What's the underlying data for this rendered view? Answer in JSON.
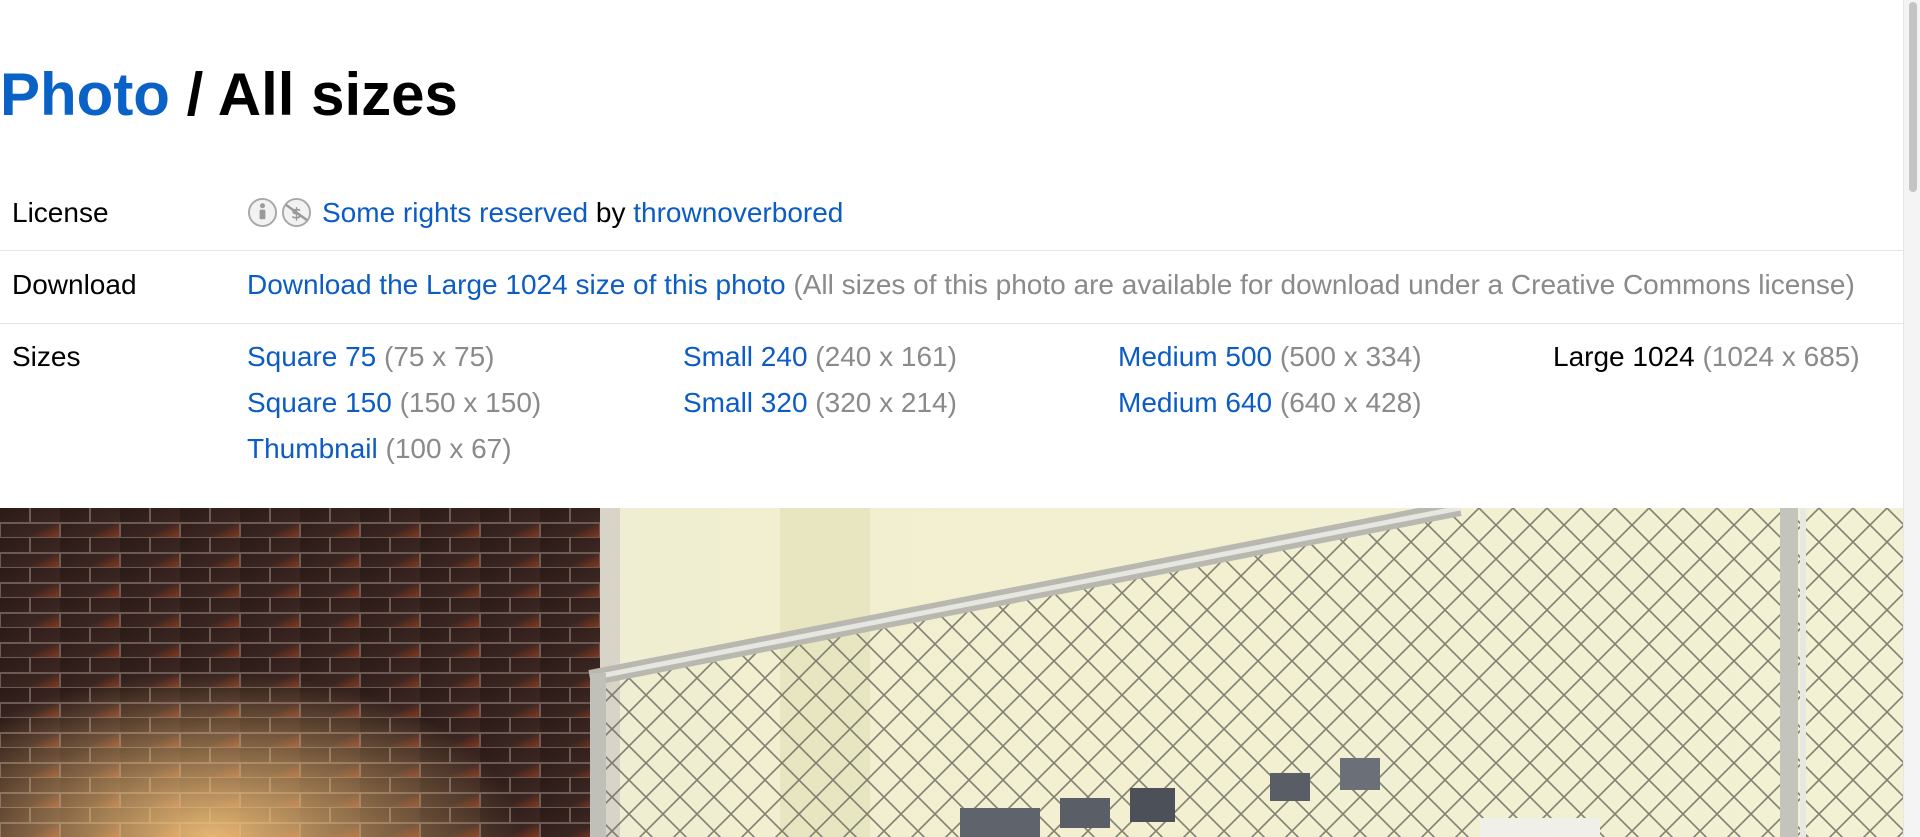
{
  "header": {
    "photo_link": "Photo",
    "separator": " / ",
    "title": "All sizes"
  },
  "license": {
    "label": "License",
    "icons": [
      "cc-attribution-icon",
      "cc-noncommercial-icon"
    ],
    "rights_link": "Some rights reserved",
    "by_text": " by ",
    "author_link": "thrownoverbored"
  },
  "download": {
    "label": "Download",
    "link": "Download the Large 1024 size of this photo",
    "note": " (All sizes of this photo are available for download under a Creative Commons license)"
  },
  "sizes": {
    "label": "Sizes",
    "items": [
      {
        "name": "Square 75",
        "dims": " (75 x 75)"
      },
      {
        "name": "Square 150",
        "dims": " (150 x 150)"
      },
      {
        "name": "Thumbnail",
        "dims": " (100 x 67)"
      },
      {
        "name": "Small 240",
        "dims": " (240 x 161)"
      },
      {
        "name": "Small 320",
        "dims": " (320 x 214)"
      },
      {
        "name": "Medium 500",
        "dims": " (500 x 334)"
      },
      {
        "name": "Medium 640",
        "dims": " (640 x 428)"
      },
      {
        "name": "Large 1024",
        "dims": " (1024 x 685)",
        "current": true
      }
    ]
  },
  "colors": {
    "link": "#0b5cc4",
    "title_link": "#0a62c7",
    "muted": "#8a8a8a",
    "divider": "#e5e5e5"
  }
}
